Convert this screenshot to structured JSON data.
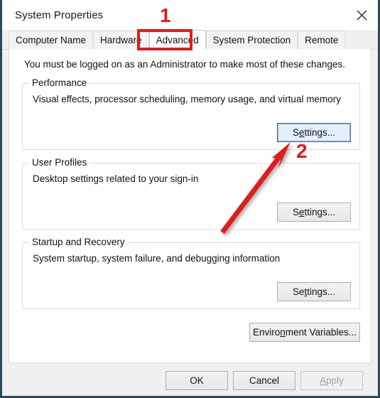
{
  "window": {
    "title": "System Properties",
    "close_icon": "close-icon"
  },
  "tabs": [
    {
      "label": "Computer Name",
      "selected": false
    },
    {
      "label": "Hardware",
      "selected": false
    },
    {
      "label": "Advanced",
      "selected": true
    },
    {
      "label": "System Protection",
      "selected": false
    },
    {
      "label": "Remote",
      "selected": false
    }
  ],
  "page": {
    "notice": "You must be logged on as an Administrator to make most of these changes."
  },
  "groups": [
    {
      "legend": "Performance",
      "description": "Visual effects, processor scheduling, memory usage, and virtual memory",
      "button": {
        "label_pre": "S",
        "label_accel": "e",
        "label_post": "ttings...",
        "accel_position": "S",
        "full_label": "Settings...",
        "focused": true
      }
    },
    {
      "legend": "User Profiles",
      "description": "Desktop settings related to your sign-in",
      "button": {
        "label_pre": "S",
        "label_accel": "e",
        "label_post": "ttings...",
        "full_label": "Settings...",
        "focused": false
      }
    },
    {
      "legend": "Startup and Recovery",
      "description": "System startup, system failure, and debugging information",
      "button": {
        "label_pre": "Se",
        "label_accel": "t",
        "label_post": "tings...",
        "full_label": "Settings...",
        "focused": false
      }
    }
  ],
  "env_button": {
    "label_pre": "Enviro",
    "label_accel": "n",
    "label_post": "ment Variables...",
    "full_label": "Environment Variables..."
  },
  "footer": {
    "ok_label": "OK",
    "cancel_label": "Cancel",
    "apply_pre": "",
    "apply_accel": "A",
    "apply_post": "pply",
    "apply_label": "Apply",
    "apply_disabled": true
  },
  "annotations": {
    "color": "#e01b1b",
    "marker_1": "1",
    "marker_2": "2",
    "highlight_target": "Advanced",
    "arrow_target": "performance-settings-button"
  }
}
